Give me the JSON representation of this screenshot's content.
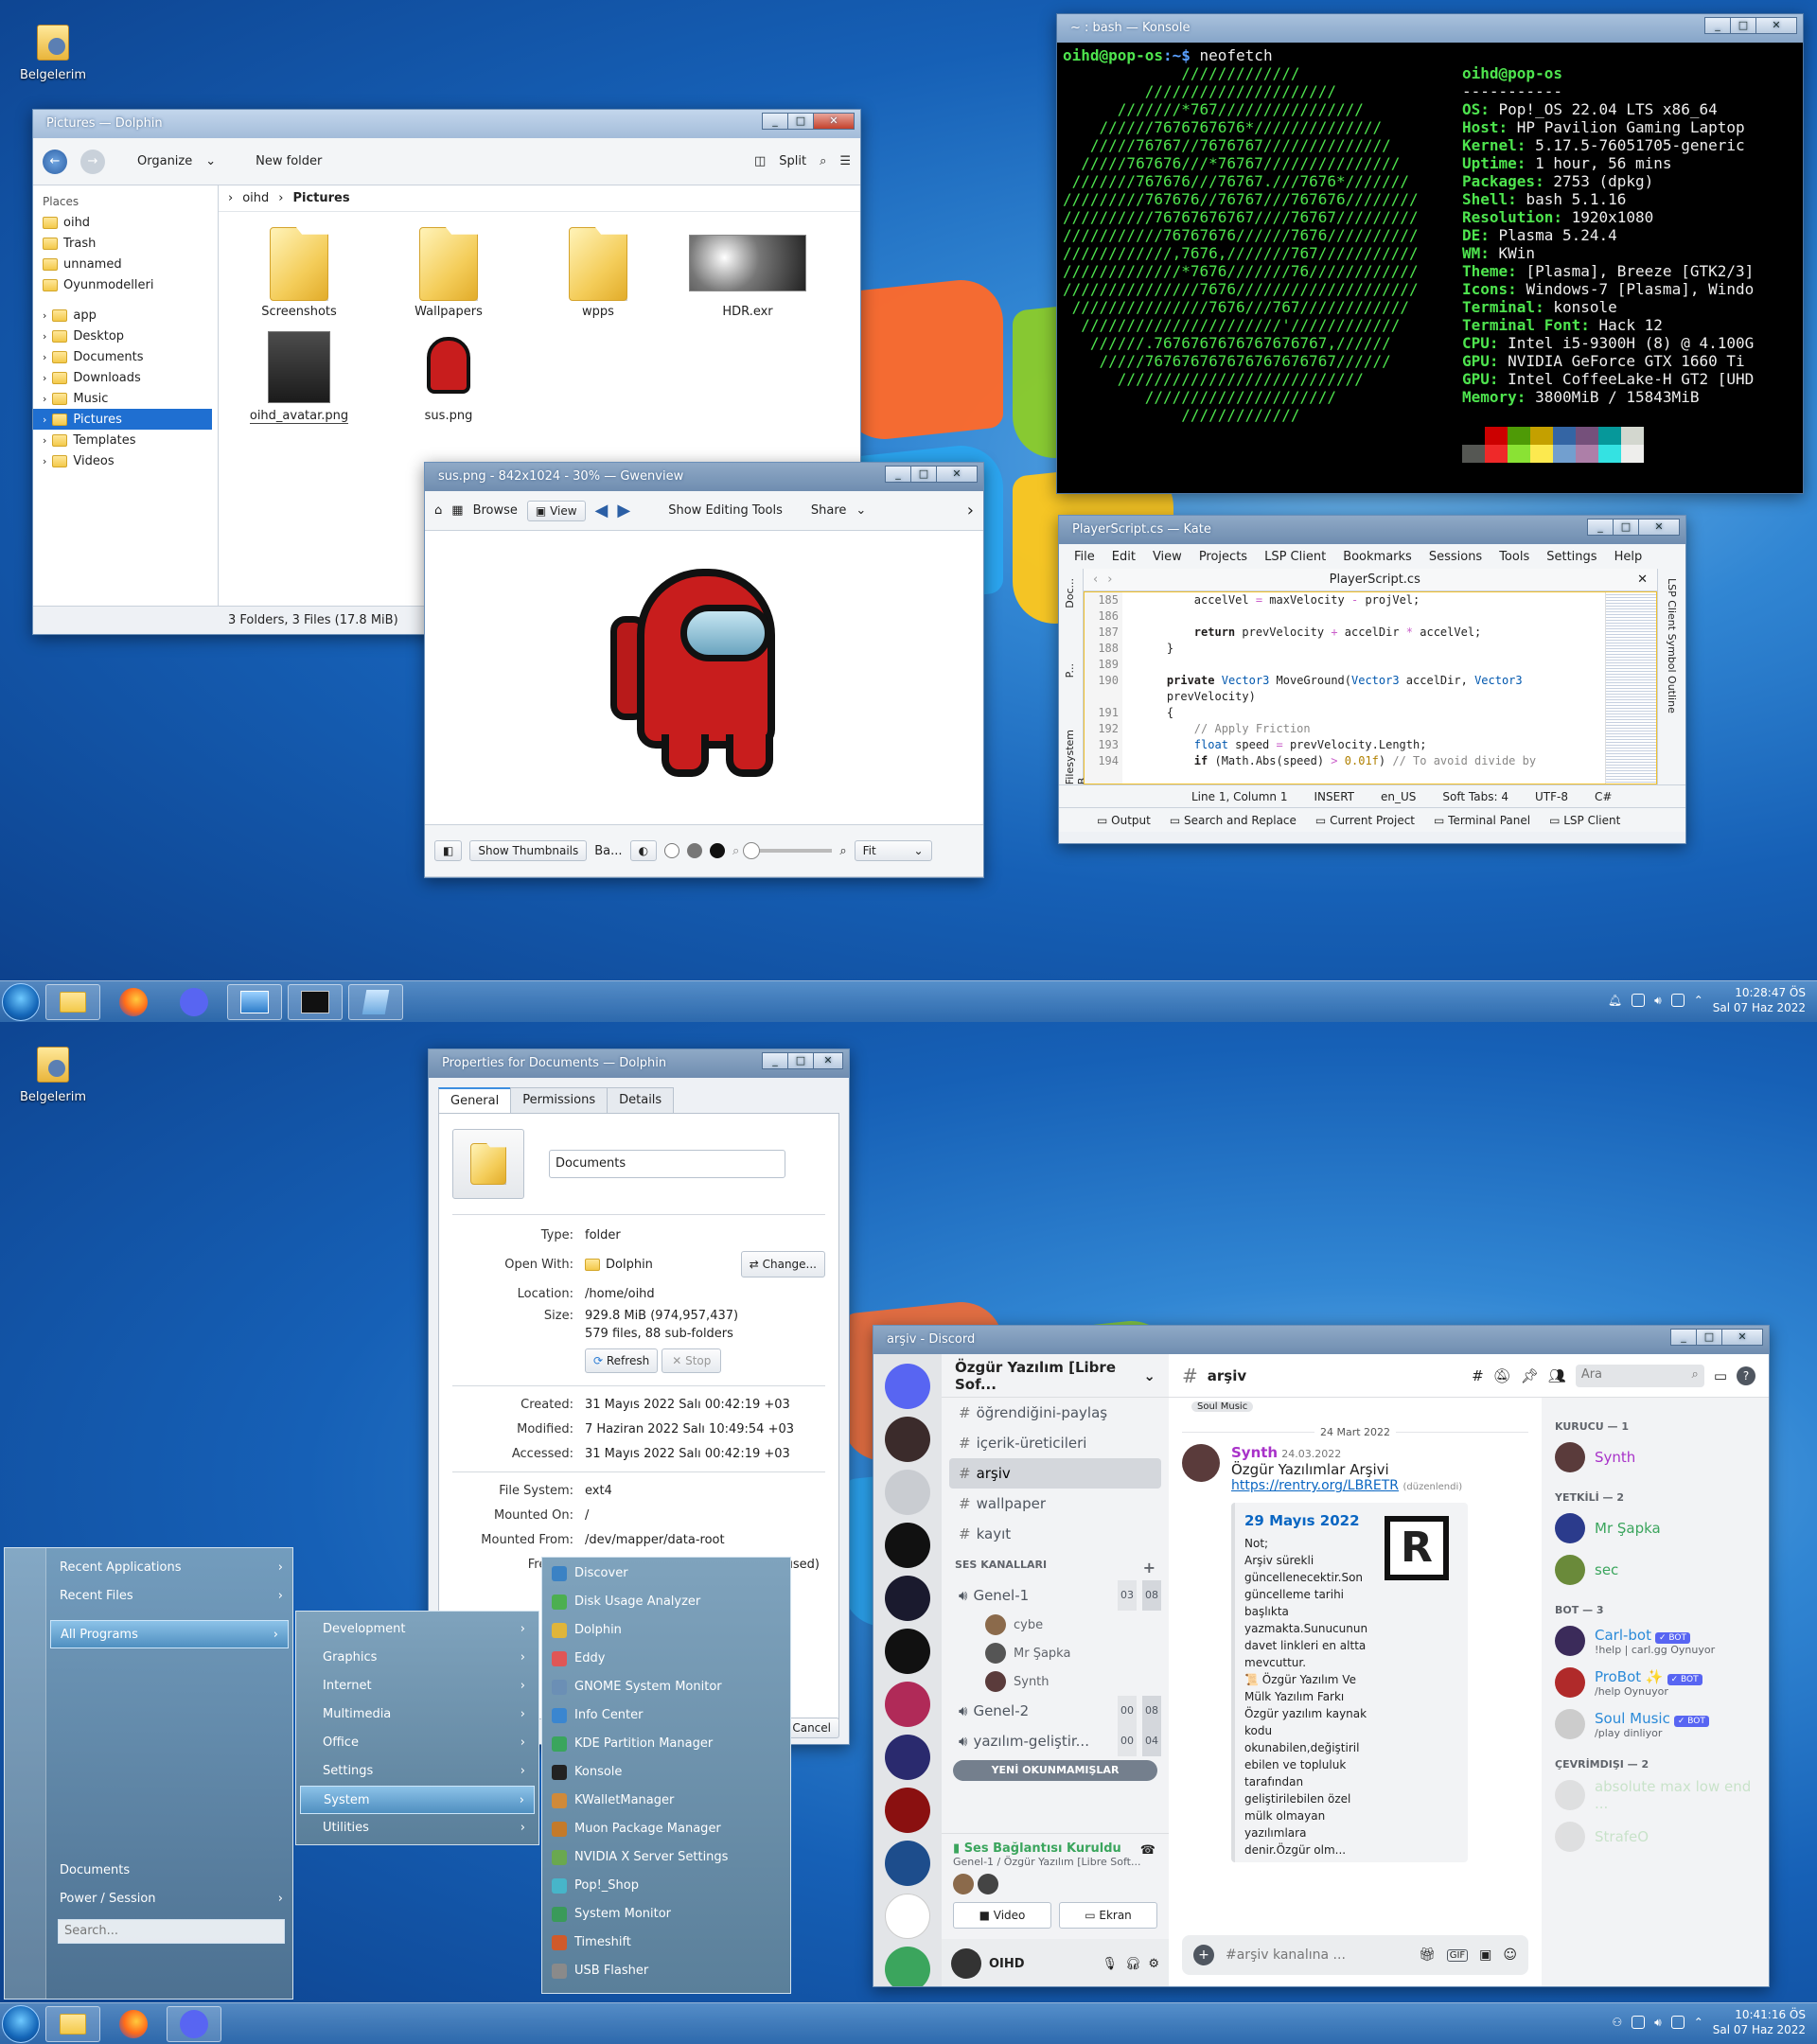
{
  "desktop_icon": {
    "label": "Belgelerim"
  },
  "dolphin": {
    "title": "Pictures — Dolphin",
    "organize": "Organize",
    "new_folder": "New folder",
    "split": "Split",
    "places_header": "Places",
    "places": [
      "oihd",
      "Trash",
      "unnamed",
      "Oyunmodelleri"
    ],
    "tree": [
      "app",
      "Desktop",
      "Documents",
      "Downloads",
      "Music",
      "Pictures",
      "Templates",
      "Videos"
    ],
    "breadcrumb": [
      "oihd",
      "Pictures"
    ],
    "files": [
      "Screenshots",
      "Wallpapers",
      "wpps",
      "HDR.exr",
      "oihd_avatar.png",
      "sus.png"
    ],
    "status": "3 Folders, 3 Files (17.8 MiB)"
  },
  "gwenview": {
    "title": "sus.png - 842x1024 - 30% — Gwenview",
    "browse": "Browse",
    "view": "View",
    "show_editing": "Show Editing Tools",
    "share": "Share",
    "show_thumbs": "Show Thumbnails",
    "ba": "Ba...",
    "zoom": "Fit"
  },
  "konsole": {
    "title": "~ : bash — Konsole",
    "prompt_user": "oihd@pop-os",
    "prompt_path": ":~$",
    "command": " neofetch",
    "logo": [
      "             /////////////",
      "         /////////////////////",
      "      ///////*767////////////////",
      "    //////7676767676*//////////////",
      "   /////76767//7676767//////////////",
      "  /////767676///*76767///////////////",
      " ///////767676///76767.///7676*///////",
      "/////////767676//76767///767676////////",
      "//////////76767676767////76767/////////",
      "///////////76767676//////7676//////////",
      "////////////,7676,///////767///////////",
      "/////////////*7676///////76////////////",
      "///////////////7676////////////////////",
      " ///////////////7676///767////////////",
      "  //////////////////////'////////////",
      "   //////.7676767676767676767,//////",
      "    /////767676767676767676767//////",
      "      ///////////////////////////",
      "         /////////////////////",
      "             /////////////"
    ],
    "host": "oihd@pop-os",
    "sep": "-----------",
    "info": [
      {
        "k": "OS",
        "v": "Pop!_OS 22.04 LTS x86_64"
      },
      {
        "k": "Host",
        "v": "HP Pavilion Gaming Laptop"
      },
      {
        "k": "Kernel",
        "v": "5.17.5-76051705-generic"
      },
      {
        "k": "Uptime",
        "v": "1 hour, 56 mins"
      },
      {
        "k": "Packages",
        "v": "2753 (dpkg)"
      },
      {
        "k": "Shell",
        "v": "bash 5.1.16"
      },
      {
        "k": "Resolution",
        "v": "1920x1080"
      },
      {
        "k": "DE",
        "v": "Plasma 5.24.4"
      },
      {
        "k": "WM",
        "v": "KWin"
      },
      {
        "k": "Theme",
        "v": "[Plasma], Breeze [GTK2/3]"
      },
      {
        "k": "Icons",
        "v": "Windows-7 [Plasma], Windo"
      },
      {
        "k": "Terminal",
        "v": "konsole"
      },
      {
        "k": "Terminal Font",
        "v": "Hack 12"
      },
      {
        "k": "CPU",
        "v": "Intel i5-9300H (8) @ 4.100G"
      },
      {
        "k": "GPU",
        "v": "NVIDIA GeForce GTX 1660 Ti"
      },
      {
        "k": "GPU",
        "v": "Intel CoffeeLake-H GT2 [UHD"
      },
      {
        "k": "Memory",
        "v": "3800MiB / 15843MiB"
      }
    ],
    "palette": [
      "#000000",
      "#cc0000",
      "#4e9a06",
      "#c4a000",
      "#3465a4",
      "#75507b",
      "#06989a",
      "#d3d7cf"
    ],
    "palette2": [
      "#555753",
      "#ef2929",
      "#8ae234",
      "#fce94f",
      "#729fcf",
      "#ad7fa8",
      "#34e2e2",
      "#eeeeec"
    ]
  },
  "kate": {
    "title": "PlayerScript.cs — Kate",
    "menu": [
      "File",
      "Edit",
      "View",
      "Projects",
      "LSP Client",
      "Bookmarks",
      "Sessions",
      "Tools",
      "Settings",
      "Help"
    ],
    "tab": "PlayerScript.cs",
    "line_numbers": [
      "185",
      "186",
      "187",
      "188",
      "189",
      "190",
      "",
      "191",
      "192",
      "193",
      "194"
    ],
    "side_left": [
      "Doc...",
      "P...",
      "Filesystem B..."
    ],
    "side_right": "LSP Client Symbol Outline",
    "status": [
      "Line 1, Column 1",
      "INSERT",
      "en_US",
      "Soft Tabs: 4",
      "UTF-8",
      "C#"
    ],
    "bottom_tabs": [
      "Output",
      "Search and Replace",
      "Current Project",
      "Terminal Panel",
      "LSP Client"
    ]
  },
  "taskbar1": {
    "time": "10:28:47 ÖS",
    "date": "Sal 07 Haz 2022"
  },
  "taskbar2": {
    "time": "10:41:16 ÖS",
    "date": "Sal 07 Haz 2022"
  },
  "props": {
    "title": "Properties for Documents — Dolphin",
    "tabs": [
      "General",
      "Permissions",
      "Details"
    ],
    "name": "Documents",
    "rows": [
      {
        "k": "Type:",
        "v": "folder"
      },
      {
        "k": "Open With:",
        "v": "Dolphin"
      },
      {
        "k": "Location:",
        "v": "/home/oihd"
      },
      {
        "k": "Size:",
        "v": "929.8 MiB (974,957,437)"
      },
      {
        "k": "",
        "v": "579 files, 88 sub-folders"
      }
    ],
    "change": "Change...",
    "refresh": "Refresh",
    "stop": "Stop",
    "dates": [
      {
        "k": "Created:",
        "v": "31 Mayıs 2022 Salı 00:42:19 +03"
      },
      {
        "k": "Modified:",
        "v": "7 Haziran 2022 Salı 10:49:54 +03"
      },
      {
        "k": "Accessed:",
        "v": "31 Mayıs 2022 Salı 00:42:19 +03"
      }
    ],
    "fs": [
      {
        "k": "File System:",
        "v": "ext4"
      },
      {
        "k": "Mounted On:",
        "v": "/"
      },
      {
        "k": "Mounted From:",
        "v": "/dev/mapper/data-root"
      },
      {
        "k": "Free Sp",
        "v": "used)"
      }
    ],
    "cancel": "Cancel"
  },
  "startmenu": {
    "main": [
      "Recent Applications",
      "Recent Files",
      "All Programs"
    ],
    "bottom": [
      "Documents",
      "Power / Session"
    ],
    "search_placeholder": "Search...",
    "categories": [
      "Development",
      "Graphics",
      "Internet",
      "Multimedia",
      "Office",
      "Settings",
      "System",
      "Utilities"
    ],
    "system_apps": [
      "Discover",
      "Disk Usage Analyzer",
      "Dolphin",
      "Eddy",
      "GNOME System Monitor",
      "Info Center",
      "KDE Partition Manager",
      "Konsole",
      "KWalletManager",
      "Muon Package Manager",
      "NVIDIA X Server Settings",
      "Pop!_Shop",
      "System Monitor",
      "Timeshift",
      "USB Flasher"
    ]
  },
  "discord": {
    "title": "arşiv - Discord",
    "server": "Özgür Yazılım [Libre Sof...",
    "channels": [
      "öğrendiğini-paylaş",
      "içerik-üreticileri",
      "arşiv",
      "wallpaper",
      "kayıt"
    ],
    "voice_header": "SES KANALLARI",
    "voice": [
      {
        "name": "Genel-1",
        "a": "03",
        "b": "08"
      },
      {
        "name": "Genel-2",
        "a": "00",
        "b": "08"
      },
      {
        "name": "yazılım-geliştir...",
        "a": "00",
        "b": "04"
      }
    ],
    "voice_users": [
      "cybe",
      "Mr Şapka",
      "Synth"
    ],
    "unread": "YENİ OKUNMAMIŞLAR",
    "conn_status": "Ses Bağlantısı Kuruldu",
    "conn_sub": "Genel-1 / Özgür Yazılım [Libre Soft...",
    "video": "Video",
    "screen": "Ekran",
    "user": "OIHD",
    "channel": "arşiv",
    "search": "Ara",
    "date_divider": "24 Mart 2022",
    "tag": "Soul Music",
    "msg_author": "Synth",
    "msg_date": "24.03.2022",
    "msg_title": "Özgür Yazılımlar Arşivi",
    "msg_link": "https://rentry.org/LBRETR",
    "msg_edited": "(düzenlendi)",
    "embed_title": "29 Mayıs 2022",
    "embed_text": "Not;\nArşiv sürekli güncellenecektir.Son güncelleme tarihi başlıkta yazmakta.Sunucunun davet linkleri en altta mevcuttur.\n📜 Özgür Yazılım Ve Mülk Yazılım Farkı\nÖzgür yazılım kaynak kodu okunabilen,değiştiril ebilen ve topluluk tarafından geliştirilebilen özel mülk olmayan yazılımlara denir.Özgür olm...",
    "input_placeholder": "#arşiv kanalına ...",
    "groups": [
      {
        "h": "KURUCU — 1",
        "m": [
          {
            "n": "Synth",
            "c": "#a832c9",
            "s": ""
          }
        ]
      },
      {
        "h": "YETKİLİ — 2",
        "m": [
          {
            "n": "Mr Şapka",
            "c": "#3ba55d",
            "s": ""
          },
          {
            "n": "sec",
            "c": "#3ba55d",
            "s": ""
          }
        ]
      },
      {
        "h": "BOT — 3",
        "m": [
          {
            "n": "Carl-bot",
            "c": "#2b8ad8",
            "s": "!help | carl.gg Oynuyor"
          },
          {
            "n": "ProBot ✨",
            "c": "#2b8ad8",
            "s": "/help Oynuyor"
          },
          {
            "n": "Soul Music",
            "c": "#2b8ad8",
            "s": "/play dinliyor"
          }
        ]
      },
      {
        "h": "ÇEVRİMDIŞI — 2",
        "m": [
          {
            "n": "absolute max low end ...",
            "c": "#9fd39f",
            "s": ""
          },
          {
            "n": "StrafeO",
            "c": "#9fd39f",
            "s": ""
          }
        ]
      }
    ],
    "bot_tag": "✓ BOT"
  }
}
